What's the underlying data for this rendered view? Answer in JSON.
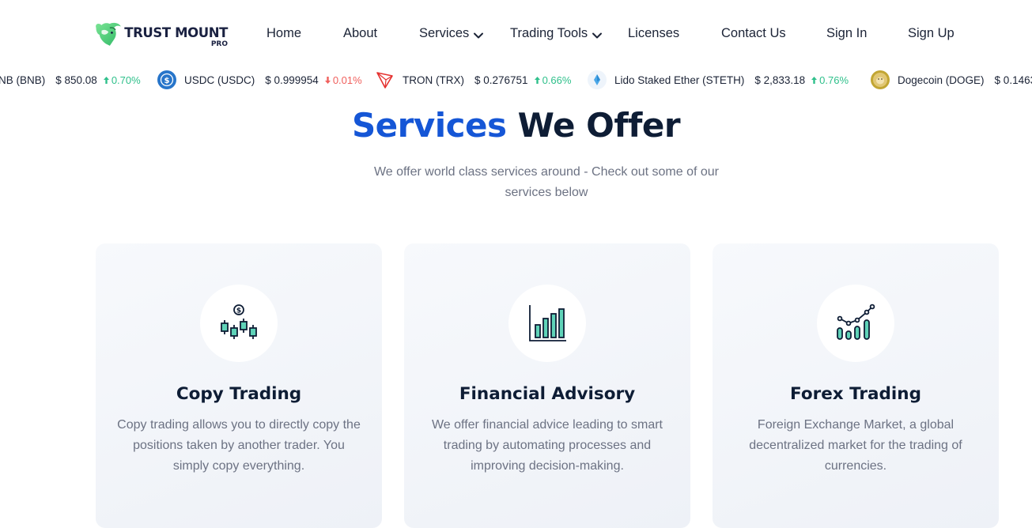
{
  "brand": {
    "name": "TRUST MOUNT",
    "sub": "PRO",
    "accent": "#2fd17f"
  },
  "nav": {
    "home": "Home",
    "about": "About",
    "services": "Services",
    "trading_tools": "Trading Tools",
    "licenses": "Licenses",
    "contact": "Contact Us",
    "sign_in": "Sign In",
    "sign_up": "Sign Up"
  },
  "ticker": [
    {
      "name": "NB (BNB)",
      "price": "$ 850.08",
      "change": "0.70%",
      "direction": "up",
      "icon": "bnb-icon"
    },
    {
      "name": "USDC (USDC)",
      "price": "$ 0.999954",
      "change": "0.01%",
      "direction": "down",
      "icon": "usdc-icon"
    },
    {
      "name": "TRON (TRX)",
      "price": "$ 0.276751",
      "change": "0.66%",
      "direction": "up",
      "icon": "tron-icon"
    },
    {
      "name": "Lido Staked Ether (STETH)",
      "price": "$ 2,833.18",
      "change": "0.76%",
      "direction": "up",
      "icon": "steth-icon"
    },
    {
      "name": "Dogecoin (DOGE)",
      "price": "$ 0.1463",
      "change": "",
      "direction": "up",
      "icon": "doge-icon"
    }
  ],
  "section": {
    "title_accent": "Services",
    "title_rest": "We Offer",
    "subtitle": "We offer world class services around - Check out some of our services below"
  },
  "cards": [
    {
      "title": "Copy Trading",
      "desc": "Copy trading allows you to directly copy the positions taken by another trader. You simply copy everything.",
      "icon": "candlestick-icon"
    },
    {
      "title": "Financial Advisory",
      "desc": "We offer financial advice leading to smart trading by automating processes and improving decision-making.",
      "icon": "bar-chart-icon"
    },
    {
      "title": "Forex Trading",
      "desc": "Foreign Exchange Market, a global decentralized market for the trading of currencies.",
      "icon": "growth-chart-icon"
    }
  ],
  "colors": {
    "accent_blue": "#1556d6",
    "dark": "#0e1d35",
    "green": "#2fc08b",
    "red": "#f0605d",
    "icon_teal": "#5fd3b8"
  }
}
